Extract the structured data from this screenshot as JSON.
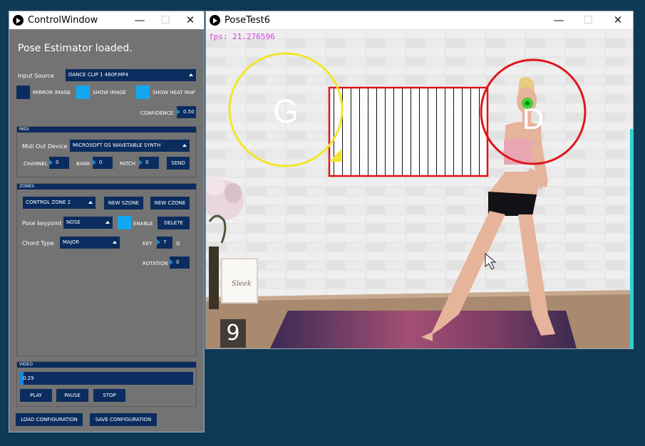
{
  "control_window": {
    "title": "ControlWindow",
    "status": "Pose Estimator loaded.",
    "input_source": {
      "label": "Input Source",
      "value": "DANCE CLIP 1 480P.MP4"
    },
    "toggles": [
      {
        "label": "MIRROR IMAGE",
        "on": false
      },
      {
        "label": "SHOW IMAGE",
        "on": true
      },
      {
        "label": "SHOW HEAT MAP",
        "on": true
      }
    ],
    "confidence": {
      "label": "CONFIDENCE",
      "value": "0.50"
    },
    "midi": {
      "header": "MIDI",
      "out_device_label": "Midi Out Device",
      "out_device_value": "MICROSOFT GS WAVETABLE SYNTH",
      "channel_label": "CHANNEL",
      "channel_value": "0",
      "bank_label": "BANK",
      "bank_value": "0",
      "patch_label": "PATCH",
      "patch_value": "0",
      "send_label": "SEND"
    },
    "zones": {
      "header": "ZONES",
      "zone_select": "CONTROL ZONE 2",
      "new_szone": "NEW SZONE",
      "new_czone": "NEW CZONE",
      "pose_keypoint_label": "Pose keypoint",
      "pose_keypoint_value": "NOSE",
      "enable_label": "ENABLE",
      "enable_on": true,
      "delete_label": "DELETE",
      "chord_type_label": "Chord Type",
      "chord_type_value": "MAJOR",
      "key_label": "KEY",
      "key_value": "7",
      "key_note": "G",
      "rotation_label": "ROTATION",
      "rotation_value": "0"
    },
    "video": {
      "header": "VIDEO",
      "position_value": "0.29",
      "position_fraction": 0.02,
      "play": "PLAY",
      "pause": "PAUSE",
      "stop": "STOP"
    },
    "load_config": "LOAD CONFIGURATION",
    "save_config": "SAVE CONFIGURATION"
  },
  "pose_window": {
    "title": "PoseTest6",
    "fps": "fps: 21.276596",
    "zone_g_label": "G",
    "zone_d_label": "D",
    "timer": "9",
    "colors": {
      "zone_g": "#f2e52a",
      "zone_d": "#e0141b",
      "control_zone": "#e0141b",
      "keypoint": "#2fd12f",
      "fps": "#d53de0"
    }
  },
  "icons": [
    "app-icon",
    "minimize-icon",
    "maximize-icon",
    "close-icon",
    "dropdown-arrow-icon",
    "mouse-cursor-icon"
  ]
}
